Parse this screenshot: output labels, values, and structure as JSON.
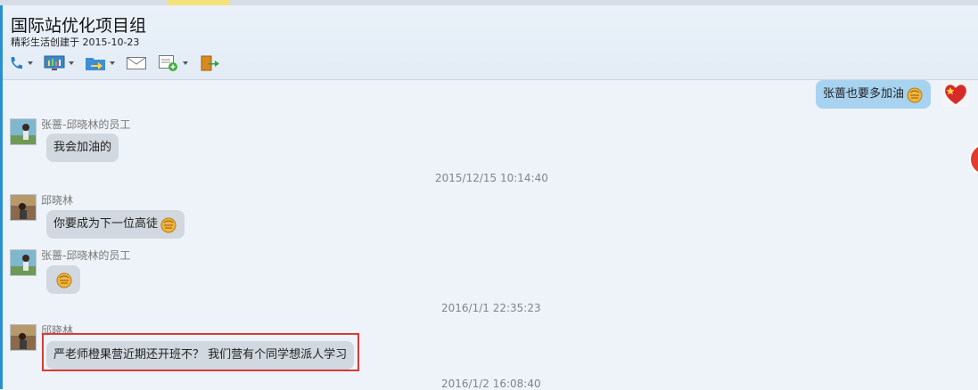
{
  "group": {
    "title": "国际站优化项目组",
    "subtitle": "精彩生活创建于 2015-10-23"
  },
  "toolbar": {
    "items": [
      {
        "icon": "phone-icon"
      },
      {
        "icon": "screen-share-icon"
      },
      {
        "icon": "file-transfer-icon"
      },
      {
        "icon": "mail-icon"
      },
      {
        "icon": "message-add-icon"
      },
      {
        "icon": "exit-icon"
      }
    ]
  },
  "messages": [
    {
      "sender": "",
      "text": "张蔷也要多加油",
      "mine": true,
      "emoji": "fist-icon"
    },
    {
      "sender": "张蔷-邱晓林的员工",
      "text": "我会加油的"
    },
    {
      "timestamp": "2015/12/15 10:14:40"
    },
    {
      "sender": "邱晓林",
      "text": "你要成为下一位高徒",
      "emoji": "fist-icon"
    },
    {
      "sender": "张蔷-邱晓林的员工",
      "text": "",
      "emoji": "fist-icon"
    },
    {
      "timestamp": "2016/1/1 22:35:23"
    },
    {
      "sender": "邱晓林",
      "text": "严老师橙果营近期还开班不？ 我们营有个同学想派人学习",
      "highlighted": true
    },
    {
      "timestamp": "2016/1/2 16:08:40"
    }
  ],
  "colors": {
    "accent": "#2a8fd0",
    "my_bubble": "#a7d3f0",
    "other_bubble": "#d2d8df",
    "highlight": "#d83a3a"
  }
}
